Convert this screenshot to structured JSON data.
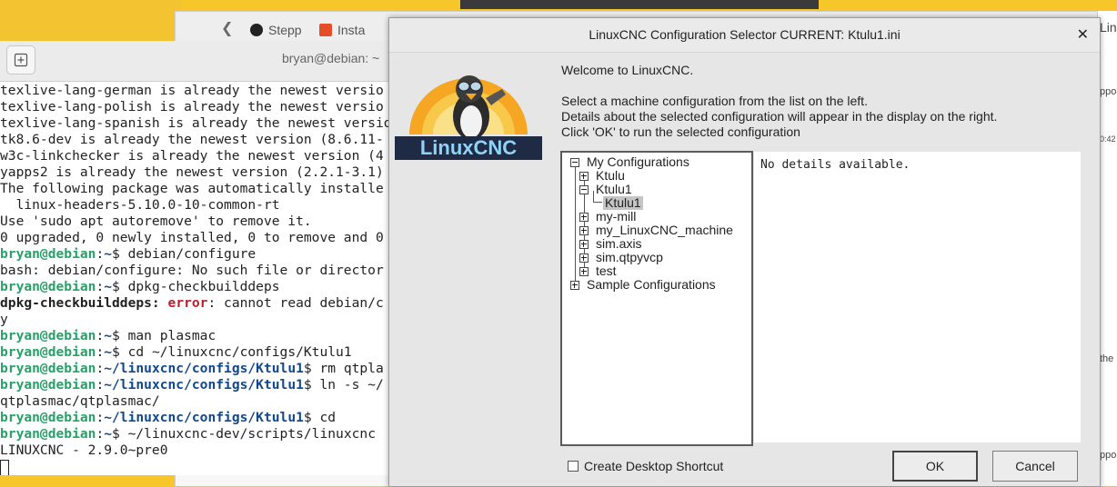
{
  "browser": {
    "tabs": [
      {
        "label": "Stepp",
        "color": "#222222"
      },
      {
        "label": "Insta",
        "color": "#e44d26"
      }
    ],
    "right_strip": [
      "Lin",
      "ppor",
      "0:42",
      "the",
      "ppor"
    ]
  },
  "terminal": {
    "title": "bryan@debian: ~",
    "lines": [
      [
        {
          "t": "texlive-lang-german is already the newest versio"
        }
      ],
      [
        {
          "t": "texlive-lang-polish is already the newest versio"
        }
      ],
      [
        {
          "t": "texlive-lang-spanish is already the newest versio"
        }
      ],
      [
        {
          "t": "tk8.6-dev is already the newest version (8.6.11-"
        }
      ],
      [
        {
          "t": "w3c-linkchecker is already the newest version (4"
        }
      ],
      [
        {
          "t": "yapps2 is already the newest version (2.2.1-3.1)"
        }
      ],
      [
        {
          "t": "The following package was automatically installe"
        }
      ],
      [
        {
          "t": "  linux-headers-5.10.0-10-common-rt"
        }
      ],
      [
        {
          "t": "Use 'sudo apt autoremove' to remove it."
        }
      ],
      [
        {
          "t": "0 upgraded, 0 newly installed, 0 to remove and 0"
        }
      ],
      [
        {
          "t": "bryan@debian",
          "c": "pg"
        },
        {
          "t": ":"
        },
        {
          "t": "~",
          "c": "pb"
        },
        {
          "t": "$ debian/configure"
        }
      ],
      [
        {
          "t": "bash: debian/configure: No such file or director"
        }
      ],
      [
        {
          "t": "bryan@debian",
          "c": "pg"
        },
        {
          "t": ":"
        },
        {
          "t": "~",
          "c": "pb"
        },
        {
          "t": "$ dpkg-checkbuilddeps"
        }
      ],
      [
        {
          "t": "dpkg-checkbuilddeps:",
          "c": "bd"
        },
        {
          "t": " "
        },
        {
          "t": "error",
          "c": "pr"
        },
        {
          "t": ": cannot read debian/c"
        }
      ],
      [
        {
          "t": "y"
        }
      ],
      [
        {
          "t": "bryan@debian",
          "c": "pg"
        },
        {
          "t": ":"
        },
        {
          "t": "~",
          "c": "pb"
        },
        {
          "t": "$ man plasmac"
        }
      ],
      [
        {
          "t": "bryan@debian",
          "c": "pg"
        },
        {
          "t": ":"
        },
        {
          "t": "~",
          "c": "pb"
        },
        {
          "t": "$ cd ~/linuxcnc/configs/Ktulu1"
        }
      ],
      [
        {
          "t": "bryan@debian",
          "c": "pg"
        },
        {
          "t": ":"
        },
        {
          "t": "~/linuxcnc/configs/Ktulu1",
          "c": "pb"
        },
        {
          "t": "$ rm qtpla"
        }
      ],
      [
        {
          "t": "bryan@debian",
          "c": "pg"
        },
        {
          "t": ":"
        },
        {
          "t": "~/linuxcnc/configs/Ktulu1",
          "c": "pb"
        },
        {
          "t": "$ ln -s ~/"
        }
      ],
      [
        {
          "t": "qtplasmac/qtplasmac/"
        }
      ],
      [
        {
          "t": "bryan@debian",
          "c": "pg"
        },
        {
          "t": ":"
        },
        {
          "t": "~/linuxcnc/configs/Ktulu1",
          "c": "pb"
        },
        {
          "t": "$ cd"
        }
      ],
      [
        {
          "t": "bryan@debian",
          "c": "pg"
        },
        {
          "t": ":"
        },
        {
          "t": "~",
          "c": "pb"
        },
        {
          "t": "$ ~/linuxcnc-dev/scripts/linuxcnc"
        }
      ],
      [
        {
          "t": "LINUXCNC - 2.9.0~pre0"
        }
      ]
    ]
  },
  "dialog": {
    "title": "LinuxCNC Configuration Selector CURRENT: Ktulu1.ini",
    "logo_text": "LinuxCNC",
    "welcome": "Welcome to LinuxCNC.",
    "desc1": "Select a machine configuration from the list on the left.",
    "desc2": "Details about the selected configuration will appear in the display on the right.",
    "desc3": "Click 'OK' to run the selected configuration",
    "tree": {
      "root1": "My Configurations",
      "items": [
        "Ktulu",
        "Ktulu1",
        "my-mill",
        "my_LinuxCNC_machine",
        "sim.axis",
        "sim.qtpyvcp",
        "test"
      ],
      "selected_child": "Ktulu1",
      "root2": "Sample Configurations"
    },
    "details": "No details available.",
    "shortcut_label": "Create Desktop Shortcut",
    "ok_label": "OK",
    "cancel_label": "Cancel"
  }
}
